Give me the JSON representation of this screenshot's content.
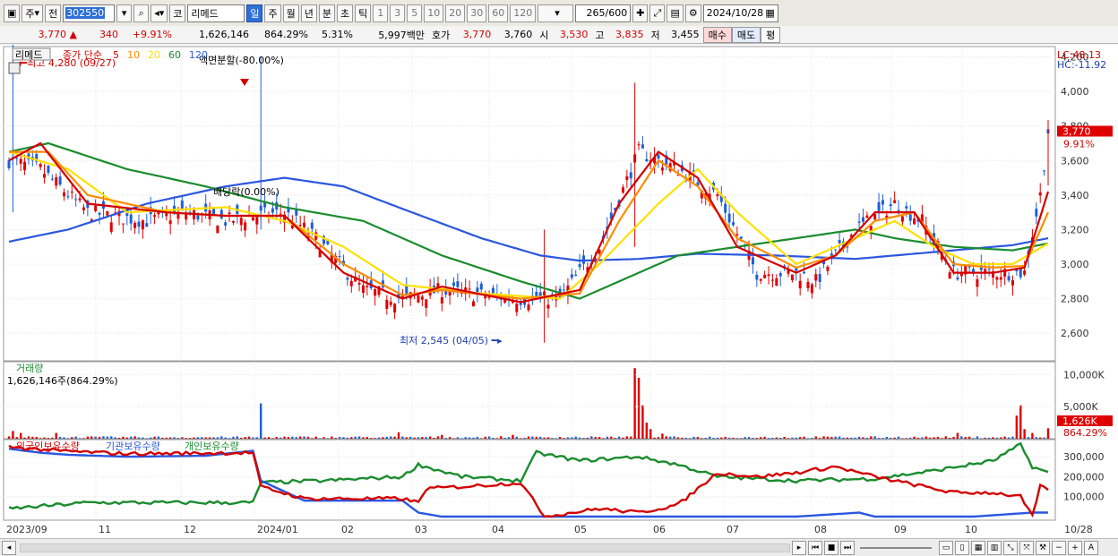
{
  "toolbar": {
    "market": "주",
    "prev_label": "전",
    "code": "302550",
    "code_prefix": "코",
    "name": "리메드",
    "periods": [
      "일",
      "주",
      "월",
      "년",
      "분",
      "초",
      "틱"
    ],
    "active_period": "일",
    "intervals": [
      "1",
      "3",
      "5",
      "10",
      "20",
      "30",
      "60",
      "120"
    ],
    "count": "265",
    "count_total": "/600",
    "date": "2024/10/28"
  },
  "quote": {
    "price": "3,770",
    "arrow": "▲",
    "change": "340",
    "change_pct": "+9.91%",
    "volume": "1,626,146",
    "volume_ratio": "864.29%",
    "turnover": "5.31%",
    "amount": "5,997백만",
    "ask_label": "호가",
    "ask": "3,770",
    "bid": "3,760",
    "open_label": "시",
    "open": "3,530",
    "high_label": "고",
    "high": "3,835",
    "low_label": "저",
    "low": "3,455",
    "buy_label": "매수",
    "sell_label": "매도",
    "avg_label": "평"
  },
  "chart_data": {
    "type": "candlestick",
    "stock_name": "리메드",
    "legend": {
      "title": "종가 단순",
      "periods": [
        "5",
        "10",
        "20",
        "60",
        "120"
      ],
      "colors": [
        "#d40000",
        "#ff8c00",
        "#ffe000",
        "#1a8c2e",
        "#2a57e0"
      ]
    },
    "lc_label": "LC:48.13",
    "hc_label": "HC:-11.92",
    "price_axis": {
      "ticks": [
        2600,
        2800,
        3000,
        3200,
        3400,
        3600,
        3800,
        4000,
        4200
      ],
      "ylim": [
        2440,
        4260
      ]
    },
    "current_price": "3,770",
    "current_change": "9.91%",
    "annotations": {
      "max": "최고 4,280 (09/27)",
      "min": "최저 2,545 (04/05)",
      "split": "액면분할(-80.00%)",
      "dividend": "배당락(0.00%)"
    },
    "price_series": {
      "months": [
        "2023/09",
        "11",
        "12",
        "2024/01",
        "02",
        "03",
        "04",
        "05",
        "06",
        "07",
        "08",
        "09",
        "10",
        "10/28"
      ],
      "close_points": [
        [
          0,
          3600
        ],
        [
          8,
          3550
        ],
        [
          20,
          3300
        ],
        [
          35,
          3250
        ],
        [
          45,
          3300
        ],
        [
          55,
          3250
        ],
        [
          62,
          3280
        ],
        [
          70,
          3300
        ],
        [
          78,
          3150
        ],
        [
          90,
          2850
        ],
        [
          100,
          2800
        ],
        [
          110,
          2850
        ],
        [
          120,
          2820
        ],
        [
          130,
          2800
        ],
        [
          140,
          2800
        ],
        [
          150,
          3100
        ],
        [
          160,
          3650
        ],
        [
          170,
          3550
        ],
        [
          180,
          3400
        ],
        [
          190,
          2950
        ],
        [
          200,
          2950
        ],
        [
          205,
          2900
        ],
        [
          215,
          3200
        ],
        [
          225,
          3350
        ],
        [
          232,
          3250
        ],
        [
          240,
          2950
        ],
        [
          250,
          2950
        ],
        [
          258,
          2950
        ],
        [
          262,
          3400
        ],
        [
          264,
          3770
        ]
      ],
      "ma5": [
        [
          0,
          3600
        ],
        [
          8,
          3700
        ],
        [
          20,
          3350
        ],
        [
          40,
          3300
        ],
        [
          55,
          3280
        ],
        [
          70,
          3280
        ],
        [
          85,
          2950
        ],
        [
          100,
          2800
        ],
        [
          110,
          2870
        ],
        [
          130,
          2780
        ],
        [
          145,
          2850
        ],
        [
          155,
          3350
        ],
        [
          165,
          3650
        ],
        [
          175,
          3500
        ],
        [
          185,
          3100
        ],
        [
          200,
          2950
        ],
        [
          210,
          3050
        ],
        [
          220,
          3300
        ],
        [
          230,
          3300
        ],
        [
          240,
          2950
        ],
        [
          250,
          2950
        ],
        [
          258,
          2980
        ],
        [
          264,
          3420
        ]
      ],
      "ma10": [
        [
          0,
          3650
        ],
        [
          10,
          3650
        ],
        [
          20,
          3400
        ],
        [
          40,
          3300
        ],
        [
          55,
          3280
        ],
        [
          70,
          3280
        ],
        [
          85,
          3000
        ],
        [
          100,
          2820
        ],
        [
          110,
          2850
        ],
        [
          130,
          2800
        ],
        [
          145,
          2830
        ],
        [
          155,
          3250
        ],
        [
          165,
          3600
        ],
        [
          175,
          3450
        ],
        [
          185,
          3150
        ],
        [
          200,
          2980
        ],
        [
          210,
          3050
        ],
        [
          220,
          3250
        ],
        [
          230,
          3300
        ],
        [
          240,
          3000
        ],
        [
          250,
          2980
        ],
        [
          258,
          2990
        ],
        [
          264,
          3300
        ]
      ],
      "ma20": [
        [
          0,
          3650
        ],
        [
          15,
          3550
        ],
        [
          30,
          3300
        ],
        [
          55,
          3330
        ],
        [
          70,
          3250
        ],
        [
          85,
          3100
        ],
        [
          100,
          2880
        ],
        [
          120,
          2830
        ],
        [
          140,
          2800
        ],
        [
          150,
          3000
        ],
        [
          165,
          3350
        ],
        [
          175,
          3550
        ],
        [
          185,
          3300
        ],
        [
          200,
          3000
        ],
        [
          215,
          3150
        ],
        [
          225,
          3250
        ],
        [
          235,
          3100
        ],
        [
          245,
          3000
        ],
        [
          255,
          3000
        ],
        [
          264,
          3120
        ]
      ],
      "ma60": [
        [
          0,
          3650
        ],
        [
          10,
          3700
        ],
        [
          30,
          3550
        ],
        [
          50,
          3450
        ],
        [
          70,
          3330
        ],
        [
          90,
          3250
        ],
        [
          110,
          3050
        ],
        [
          130,
          2900
        ],
        [
          145,
          2800
        ],
        [
          155,
          2900
        ],
        [
          170,
          3050
        ],
        [
          185,
          3100
        ],
        [
          200,
          3150
        ],
        [
          215,
          3200
        ],
        [
          225,
          3150
        ],
        [
          240,
          3100
        ],
        [
          255,
          3080
        ],
        [
          264,
          3120
        ]
      ],
      "ma120": [
        [
          0,
          3130
        ],
        [
          15,
          3200
        ],
        [
          35,
          3350
        ],
        [
          55,
          3450
        ],
        [
          70,
          3500
        ],
        [
          85,
          3450
        ],
        [
          100,
          3320
        ],
        [
          120,
          3150
        ],
        [
          135,
          3050
        ],
        [
          145,
          3020
        ],
        [
          160,
          3030
        ],
        [
          175,
          3060
        ],
        [
          195,
          3050
        ],
        [
          215,
          3030
        ],
        [
          230,
          3060
        ],
        [
          245,
          3090
        ],
        [
          255,
          3110
        ],
        [
          264,
          3150
        ]
      ]
    },
    "volume_panel": {
      "title": "거래량",
      "summary": "1,626,146주(864.29%)",
      "ticks": [
        "10,000K",
        "5,000K"
      ],
      "current": "1,626K",
      "current_pct": "864.29%",
      "ylim": [
        0,
        12000
      ],
      "spikes": [
        [
          1,
          1200
        ],
        [
          3,
          900
        ],
        [
          12,
          900
        ],
        [
          64,
          5500
        ],
        [
          99,
          1000
        ],
        [
          110,
          600
        ],
        [
          128,
          600
        ],
        [
          159,
          11000
        ],
        [
          160,
          9500
        ],
        [
          161,
          5200
        ],
        [
          162,
          2500
        ],
        [
          163,
          1500
        ],
        [
          166,
          800
        ],
        [
          241,
          900
        ],
        [
          256,
          3600
        ],
        [
          257,
          5200
        ],
        [
          258,
          1500
        ],
        [
          260,
          900
        ],
        [
          264,
          1626
        ]
      ]
    },
    "holding_panel": {
      "series_names": [
        "외국인보유수량",
        "기관보유수량",
        "개인보유수량"
      ],
      "colors": [
        "#d40000",
        "#2a57e0",
        "#1a8c2e"
      ],
      "ticks": [
        "300,000",
        "200,000",
        "100,000"
      ],
      "ylim": [
        0,
        350000
      ],
      "foreign": [
        [
          0,
          350000
        ],
        [
          12,
          330000
        ],
        [
          30,
          315000
        ],
        [
          62,
          320000
        ],
        [
          64,
          150000
        ],
        [
          75,
          90000
        ],
        [
          100,
          90000
        ],
        [
          104,
          70000
        ],
        [
          106,
          140000
        ],
        [
          115,
          150000
        ],
        [
          130,
          170000
        ],
        [
          134,
          60000
        ],
        [
          136,
          0
        ],
        [
          150,
          40000
        ],
        [
          160,
          20000
        ],
        [
          170,
          60000
        ],
        [
          180,
          220000
        ],
        [
          190,
          200000
        ],
        [
          200,
          220000
        ],
        [
          210,
          250000
        ],
        [
          220,
          200000
        ],
        [
          230,
          160000
        ],
        [
          240,
          120000
        ],
        [
          250,
          120000
        ],
        [
          257,
          100000
        ],
        [
          260,
          0
        ],
        [
          262,
          150000
        ],
        [
          264,
          140000
        ]
      ],
      "institution": [
        [
          0,
          340000
        ],
        [
          8,
          320000
        ],
        [
          15,
          310000
        ],
        [
          30,
          300000
        ],
        [
          50,
          305000
        ],
        [
          62,
          330000
        ],
        [
          64,
          180000
        ],
        [
          75,
          80000
        ],
        [
          100,
          80000
        ],
        [
          104,
          20000
        ],
        [
          110,
          0
        ],
        [
          140,
          0
        ],
        [
          160,
          0
        ],
        [
          200,
          0
        ],
        [
          216,
          20000
        ],
        [
          220,
          0
        ],
        [
          245,
          0
        ],
        [
          260,
          20000
        ],
        [
          264,
          20000
        ]
      ],
      "individual": [
        [
          0,
          40000
        ],
        [
          20,
          70000
        ],
        [
          40,
          70000
        ],
        [
          62,
          70000
        ],
        [
          64,
          170000
        ],
        [
          80,
          180000
        ],
        [
          100,
          200000
        ],
        [
          104,
          260000
        ],
        [
          115,
          200000
        ],
        [
          130,
          180000
        ],
        [
          134,
          320000
        ],
        [
          145,
          280000
        ],
        [
          160,
          300000
        ],
        [
          170,
          260000
        ],
        [
          180,
          200000
        ],
        [
          200,
          180000
        ],
        [
          220,
          190000
        ],
        [
          235,
          230000
        ],
        [
          250,
          280000
        ],
        [
          257,
          360000
        ],
        [
          260,
          250000
        ],
        [
          264,
          220000
        ]
      ]
    }
  }
}
